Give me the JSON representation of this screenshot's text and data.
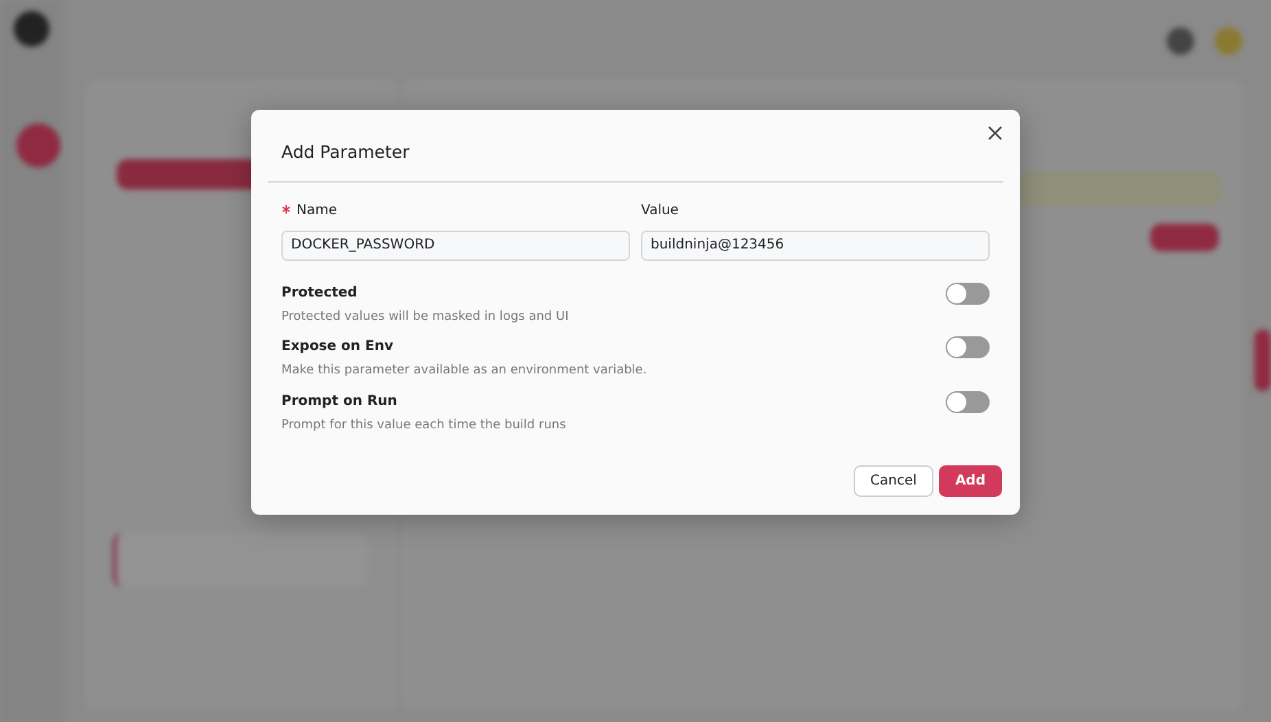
{
  "dialog": {
    "title": "Add Parameter",
    "fields": [
      {
        "label": "Name",
        "required": true,
        "value": "DOCKER_PASSWORD"
      },
      {
        "label": "Value",
        "required": false,
        "value": "buildninja@123456"
      }
    ],
    "options": [
      {
        "label": "Protected",
        "description": "Protected values will be masked in logs and UI",
        "on": false
      },
      {
        "label": "Expose on Env",
        "description": "Make this parameter available as an environment variable.",
        "on": false
      },
      {
        "label": "Prompt on Run",
        "description": "Prompt for this value each time the build runs",
        "on": false
      }
    ],
    "buttons": [
      {
        "label": "Cancel",
        "kind": "secondary"
      },
      {
        "label": "Add",
        "kind": "primary"
      }
    ]
  }
}
